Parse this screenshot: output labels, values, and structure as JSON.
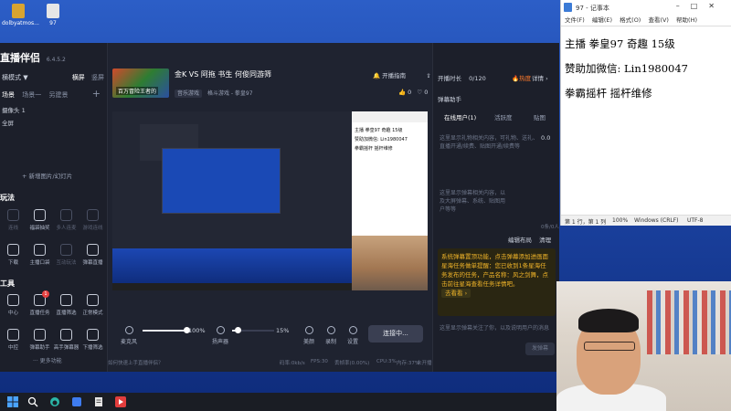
{
  "desktop": {
    "icons": [
      {
        "label": "dolbyatmos...",
        "color": "#d8a431"
      },
      {
        "label": "97",
        "color": "#e6e6e6"
      }
    ]
  },
  "app": {
    "brand": "直播伴侣",
    "version": "6.4.5.2",
    "mode_label": "横模式 ▼",
    "mode_options": [
      "横屏",
      "竖屏"
    ],
    "scene_tabs": [
      "场景",
      "场景一",
      "另建景"
    ],
    "sources": [
      "摄像头 1",
      "全屏"
    ],
    "add_scene": "+ 新增图片/幻灯片",
    "section_play": "玩法",
    "tools_row1": [
      {
        "label": "连线",
        "dim": true
      },
      {
        "label": "福袋抽奖",
        "dim": false
      },
      {
        "label": "多人连麦",
        "dim": true
      },
      {
        "label": "游戏连线",
        "dim": true
      }
    ],
    "tools_row2": [
      {
        "label": "下载",
        "dim": false
      },
      {
        "label": "主播口袋",
        "dim": false
      },
      {
        "label": "互动玩法",
        "dim": true
      },
      {
        "label": "弹幕直播",
        "dim": false
      }
    ],
    "section_tools": "工具",
    "tools_row3": [
      {
        "label": "中心",
        "dim": false
      },
      {
        "label": "直播任务",
        "dim": false,
        "badge": "1"
      },
      {
        "label": "直播筛选",
        "dim": false
      },
      {
        "label": "正常模式",
        "dim": false
      }
    ],
    "tools_row4": [
      {
        "label": "中控",
        "dim": false
      },
      {
        "label": "弹幕助手",
        "dim": false
      },
      {
        "label": "高手弹幕器",
        "dim": false
      },
      {
        "label": "下播筛选",
        "dim": false
      }
    ],
    "more_functions": "··· 更多功能",
    "stream": {
      "cover_text": "百万冒险王者的",
      "title": "金K VS 阿拖  书生  何俊同游筛",
      "category_tag": "音乐游戏",
      "category": "格斗游戏 - 拳皇97",
      "open_button": "开播指南",
      "share_button": "分享",
      "likes": "0",
      "hearts": "0"
    },
    "preview_notepad_lines": [
      "主播 拳皇97 奇趣 15级",
      "赞助加微信: Lin1980047",
      "拳霸摇杆  摇杆维修"
    ],
    "controls": {
      "mic_label": "麦克风",
      "mic_volume": "100%",
      "mic_level": 1.0,
      "speaker_label": "扬声器",
      "speaker_volume": "15%",
      "speaker_level": 0.15,
      "beauty_label": "美颜",
      "record_label": "录制",
      "settings_label": "设置",
      "live_button": "连接中..."
    },
    "status_bar": {
      "help": "如何快速上手直播伴侣？",
      "bitrate": "码率:0kb/s",
      "fps": "FPS:30",
      "dropped": "丢帧率(0.00%)",
      "cpu": "CPU:3%",
      "memory": "内存:37%",
      "network": "未开播"
    },
    "right_panel": {
      "live_time_label": "开播时长",
      "audience": "0/120",
      "hot": "热度",
      "details": "详情 ›",
      "danmu_helper": "弹幕助手",
      "tabs": [
        "在线用户(1)",
        "活跃度",
        "贴图"
      ],
      "hint_gift": "这里显示礼物相关内容，可礼物、送礼、直播开通/续费、贴图开通/续费等",
      "gift_score": "0.0",
      "char_count": "0条/0人",
      "hint_danmu": "这里显示弹幕相关内容，以及大屏弹幕、系统、贴图用户等等",
      "mini_buttons": [
        "编辑布局",
        "清理"
      ],
      "danmu_notice": "系统弹幕置顶功能，点击弹幕添加进画面",
      "task_notice": "星海任务做单提醒：您已收到1条星海任务发布的任务，产品名称：风之剑舞，点击前往星海查看任务详情吧。",
      "goto_label": "去看看 ›",
      "input_placeholder": "这里显示弹幕关注了你，以及说明用户的消息",
      "send_button": "发弹幕"
    }
  },
  "notepad": {
    "title": "97 - 记事本",
    "menu": [
      "文件(F)",
      "编辑(E)",
      "格式(O)",
      "查看(V)",
      "帮助(H)"
    ],
    "lines": [
      "主播 拳皇97 奇趣 15级",
      "赞助加微信: Lin1980047",
      "拳霸摇杆  摇杆维修"
    ],
    "status": {
      "position": "第 1 行，第 1 列",
      "zoom": "100%",
      "eol": "Windows (CRLF)",
      "encoding": "UTF-8"
    }
  },
  "colors": {
    "accent_orange": "#ff7a2b",
    "notice_yellow": "#f0b429",
    "desktop_blue": "#1c44a4"
  }
}
